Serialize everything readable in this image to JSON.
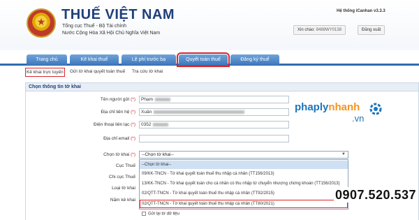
{
  "header": {
    "title": "THUẾ VIỆT NAM",
    "subtitle1": "Tổng cục Thuế - Bộ Tài chính",
    "subtitle2": "Nước Cộng Hòa Xã Hội Chủ Nghĩa Việt Nam",
    "version": "Hệ thống iCanhan v3.3.3",
    "greeting_label": "Xin chào:",
    "greeting_user": "8488WY0138",
    "logout_label": "Đăng xuất"
  },
  "nav": {
    "tabs": [
      {
        "label": "Trang chủ"
      },
      {
        "label": "Kê khai thuế"
      },
      {
        "label": "Lệ phí trước bạ"
      },
      {
        "label": "Quyết toán thuế"
      },
      {
        "label": "Đăng ký thuế"
      }
    ],
    "active_tab_highlight_color": "#d9262b"
  },
  "subnav": {
    "items": [
      {
        "label": "Kê khai trực tuyến"
      },
      {
        "label": "Gửi tờ khai quyết toán thuế"
      },
      {
        "label": "Tra cứu tờ khai"
      }
    ]
  },
  "form": {
    "section_title": "Chọn thông tin tờ khai",
    "sender_name": {
      "label": "Tên người gửi",
      "value": "Phạm"
    },
    "address": {
      "label": "Địa chỉ liên hệ",
      "value": "Xuân"
    },
    "phone": {
      "label": "Điện thoại liên lạc",
      "value": "0352"
    },
    "email": {
      "label": "Địa chỉ email",
      "value": ""
    },
    "required_mark": "(*)",
    "labels": {
      "declaration": "Chọn tờ khai",
      "tax_dept": "Cục Thuế",
      "branch": "Chi cục Thuế",
      "type": "Loại tờ khai",
      "year": "Năm kê khai"
    },
    "declaration_select": {
      "selected": "--Chọn tờ khai--",
      "options": [
        "--Chọn tờ khai--",
        "09/KK-TNCN - Tờ khai quyết toán thuế thu nhập cá nhân (TT156/2013)",
        "13/KK-TNCN - Tờ khai quyết toán cho cá nhân có thu nhập từ chuyển nhượng chứng khoán (TT156/2013)",
        "02/QTT-TNCN - Tờ khai quyết toán thuế thu nhập cá nhân (TT92/2015)",
        "02/QTT-TNCN - Tờ khai quyết toán thuế thu nhập cá nhân (TT80/2021)"
      ]
    },
    "checkbox_label": "Gửi lại tờ dữ liệu"
  },
  "watermark": {
    "brand_part1": "phaply",
    "brand_part2": "nhanh",
    "brand_domain": ".vn",
    "brand_color": "#1b75bc",
    "accent_color": "#f7941d",
    "hotline": "0907.520.537"
  }
}
